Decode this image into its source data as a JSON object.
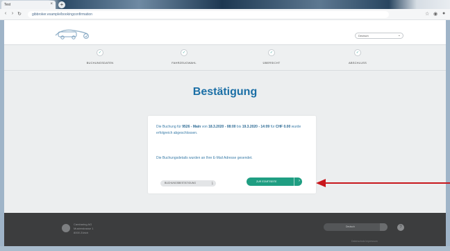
{
  "browser": {
    "tab_title": "Test",
    "url": "gibbroker.example/bookingconfirmation",
    "new_tab": "+"
  },
  "header": {
    "language_selector": "Deutsch"
  },
  "steps": [
    {
      "label": "BUCHUNGSDATEN",
      "check": "✓"
    },
    {
      "label": "FAHRZEUGWAHL",
      "check": "✓"
    },
    {
      "label": "ÜBERSICHT",
      "check": "✓"
    },
    {
      "label": "ABSCHLUSS",
      "check": "✓"
    }
  ],
  "main": {
    "title": "Bestätigung",
    "message_prefix": "Die Buchung für ",
    "vehicle": "9526 - Main",
    "message_from": " von ",
    "start": "18.3.2020 - 08:00",
    "message_to": " bis ",
    "end": "19.3.2020 - 14:09",
    "message_for": " für ",
    "price": "CHF 0.00",
    "message_suffix": " wurde erfolgreich abgeschlossen.",
    "email_note": "Die Buchungsdetails wurden an Ihre E-Mail Adresse gesendet.",
    "download_label": "BUCHUNGSBESTÄTIGUNG",
    "home_label": "ZUR STARTSEITE"
  },
  "footer": {
    "company": "Carsharing AG",
    "address": "Musterstrasse 1",
    "city": "8000 Zürich",
    "language": "Deutsch",
    "links": "Datenschutz    Impressum"
  },
  "colors": {
    "accent_blue": "#1b6fa6",
    "accent_green": "#1f9e82",
    "annotation_red": "#c8161c"
  }
}
